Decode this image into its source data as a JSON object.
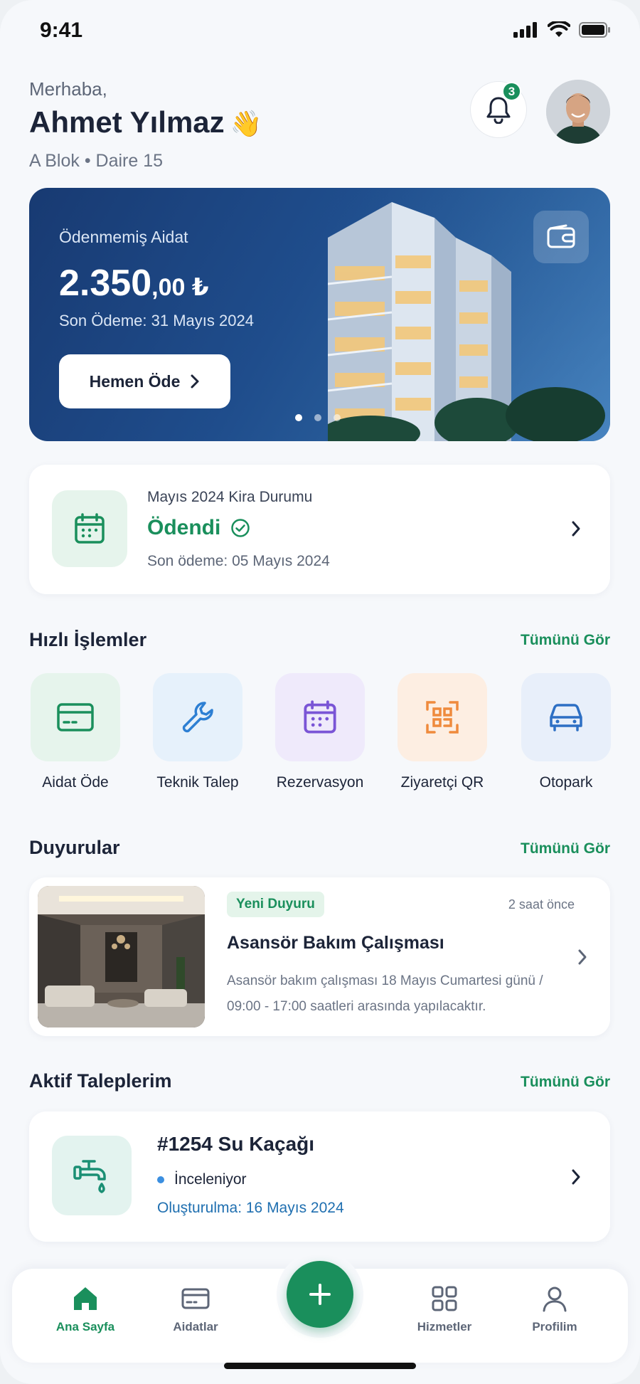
{
  "status_bar": {
    "time": "9:41"
  },
  "header": {
    "greeting": "Merhaba,",
    "name": "Ahmet Yılmaz",
    "wave_emoji": "👋",
    "unit": "A Blok • Daire 15",
    "notification_count": "3"
  },
  "hero": {
    "label": "Ödenmemiş Aidat",
    "amount_main": "2.350",
    "amount_decimal": ",00 ₺",
    "due_text": "Son Ödeme: 31 Mayıs 2024",
    "pay_button": "Hemen Öde",
    "carousel_active_index": 0,
    "carousel_count": 3
  },
  "rent": {
    "title": "Mayıs 2024 Kira Durumu",
    "status": "Ödendi",
    "last_payment": "Son ödeme: 05 Mayıs 2024"
  },
  "quick_actions": {
    "title": "Hızlı İşlemler",
    "see_all": "Tümünü Gör",
    "items": [
      {
        "label": "Aidat Öde",
        "icon": "card-icon",
        "color": "#1a8f5c",
        "bg": "#e6f4ec"
      },
      {
        "label": "Teknik Talep",
        "icon": "wrench-icon",
        "color": "#2d7fd3",
        "bg": "#e6f1fb"
      },
      {
        "label": "Rezervasyon",
        "icon": "calendar-icon",
        "color": "#7a55d6",
        "bg": "#efeafb"
      },
      {
        "label": "Ziyaretçi QR",
        "icon": "qr-scan-icon",
        "color": "#ef8a3c",
        "bg": "#fdeee2"
      },
      {
        "label": "Otopark",
        "icon": "car-icon",
        "color": "#2d6fc4",
        "bg": "#e8effa"
      }
    ]
  },
  "announcements": {
    "title": "Duyurular",
    "see_all": "Tümünü Gör",
    "item": {
      "badge": "Yeni Duyuru",
      "time": "2 saat önce",
      "title": "Asansör Bakım Çalışması",
      "description": "Asansör bakım çalışması 18 Mayıs Cumartesi günü / 09:00 - 17:00 saatleri arasında yapılacaktır."
    }
  },
  "requests": {
    "title": "Aktif Taleplerim",
    "see_all": "Tümünü Gör",
    "item": {
      "title": "#1254 Su Kaçağı",
      "status": "İnceleniyor",
      "created": "Oluşturulma: 16 Mayıs 2024"
    }
  },
  "bottom_nav": {
    "items": [
      {
        "label": "Ana Sayfa",
        "icon": "home-icon",
        "active": true
      },
      {
        "label": "Aidatlar",
        "icon": "card-icon",
        "active": false
      },
      {
        "label": "Hizmetler",
        "icon": "grid-icon",
        "active": false
      },
      {
        "label": "Profilim",
        "icon": "user-icon",
        "active": false
      }
    ],
    "fab_icon": "plus-icon"
  },
  "colors": {
    "accent": "#1a8f5c",
    "hero_gradient_start": "#183a72",
    "hero_gradient_end": "#3c78b5",
    "status_dot": "#3b8fe0"
  }
}
